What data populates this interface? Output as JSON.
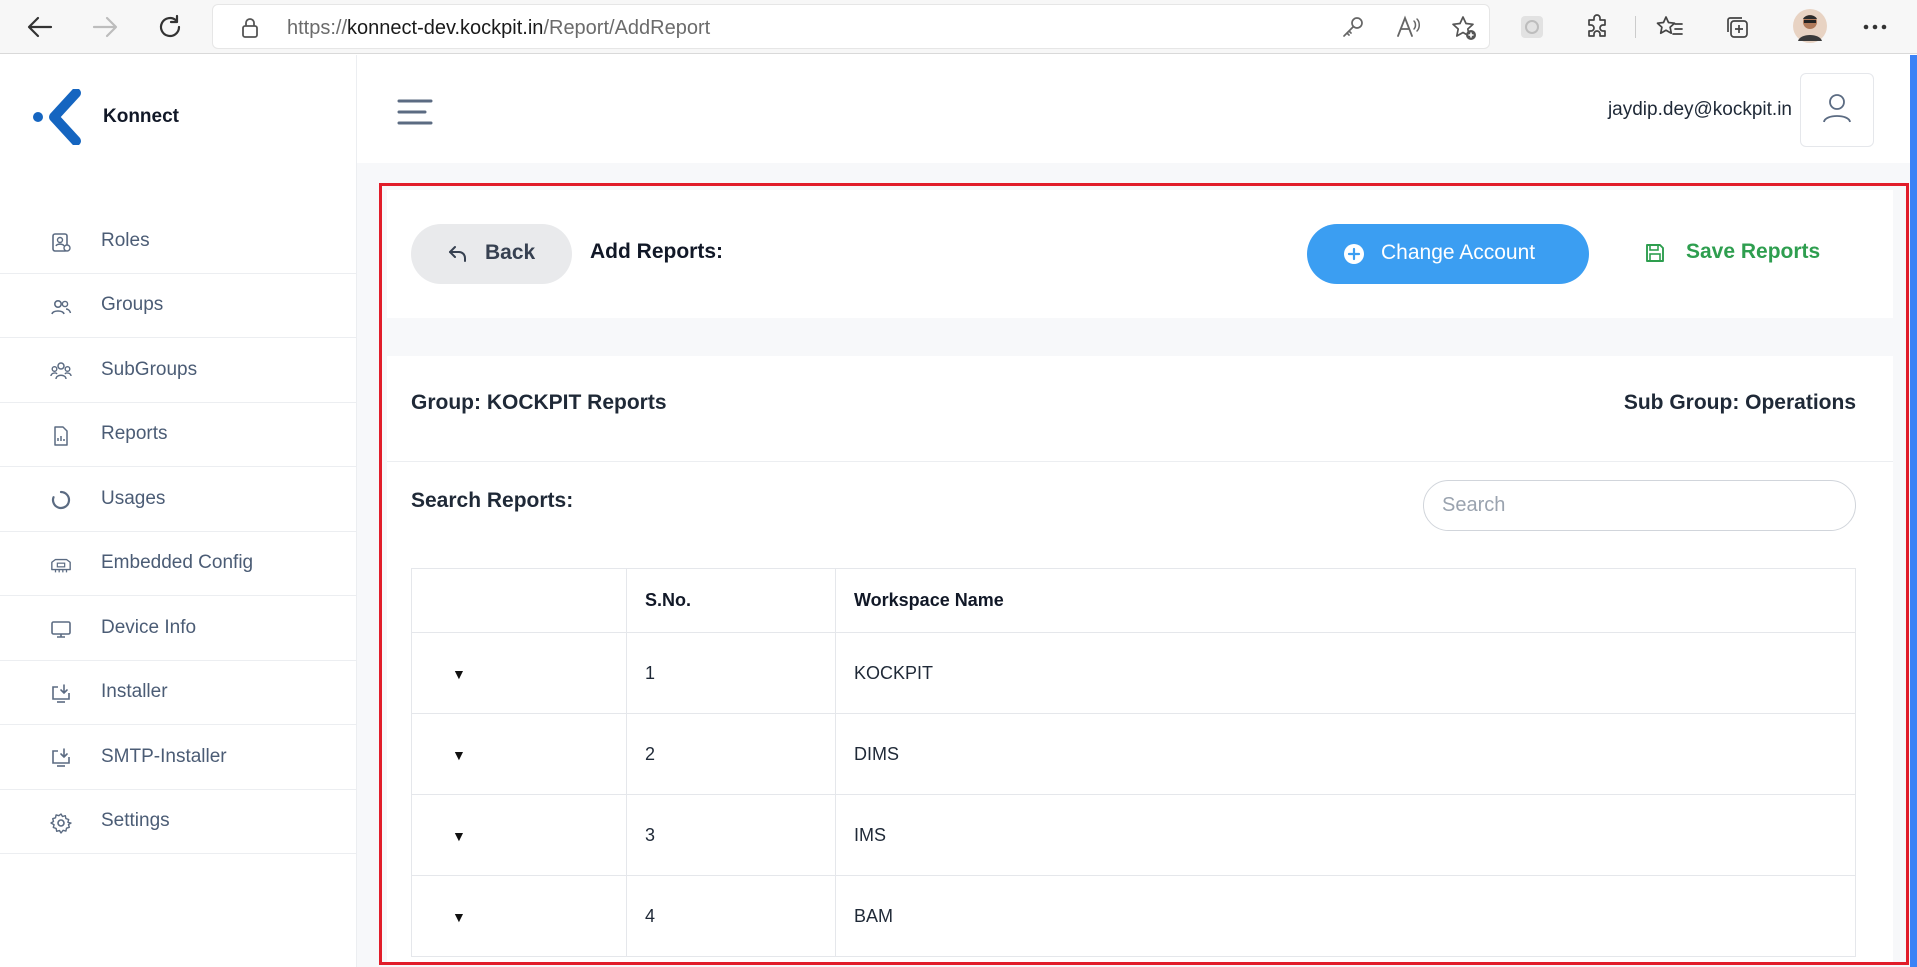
{
  "browser": {
    "url_prefix": "https://",
    "url_host": "konnect-dev.kockpit.in",
    "url_path": "/Report/AddReport"
  },
  "app": {
    "name": "Konnect",
    "accent_color": "#3b9ef2",
    "logo_color": "#1565c0"
  },
  "sidebar": {
    "items": [
      {
        "label": "Roles",
        "icon": "roles-icon"
      },
      {
        "label": "Groups",
        "icon": "groups-icon"
      },
      {
        "label": "SubGroups",
        "icon": "subgroups-icon"
      },
      {
        "label": "Reports",
        "icon": "reports-icon"
      },
      {
        "label": "Usages",
        "icon": "usages-icon"
      },
      {
        "label": "Embedded Config",
        "icon": "embedded-config-icon"
      },
      {
        "label": "Device Info",
        "icon": "device-info-icon"
      },
      {
        "label": "Installer",
        "icon": "installer-icon"
      },
      {
        "label": "SMTP-Installer",
        "icon": "smtp-installer-icon"
      },
      {
        "label": "Settings",
        "icon": "settings-icon"
      }
    ]
  },
  "header": {
    "user_email": "jaydip.dey@kockpit.in"
  },
  "toolbar": {
    "back_label": "Back",
    "title": "Add Reports:",
    "change_account_label": "Change Account",
    "save_reports_label": "Save Reports"
  },
  "details": {
    "group": "Group: KOCKPIT Reports",
    "sub_group": "Sub Group: Operations"
  },
  "search": {
    "label": "Search Reports:",
    "placeholder": "Search",
    "value": ""
  },
  "table": {
    "columns": [
      "",
      "S.No.",
      "Workspace Name"
    ],
    "rows": [
      {
        "sno": "1",
        "workspace": "KOCKPIT"
      },
      {
        "sno": "2",
        "workspace": "DIMS"
      },
      {
        "sno": "3",
        "workspace": "IMS"
      },
      {
        "sno": "4",
        "workspace": "BAM"
      }
    ]
  }
}
